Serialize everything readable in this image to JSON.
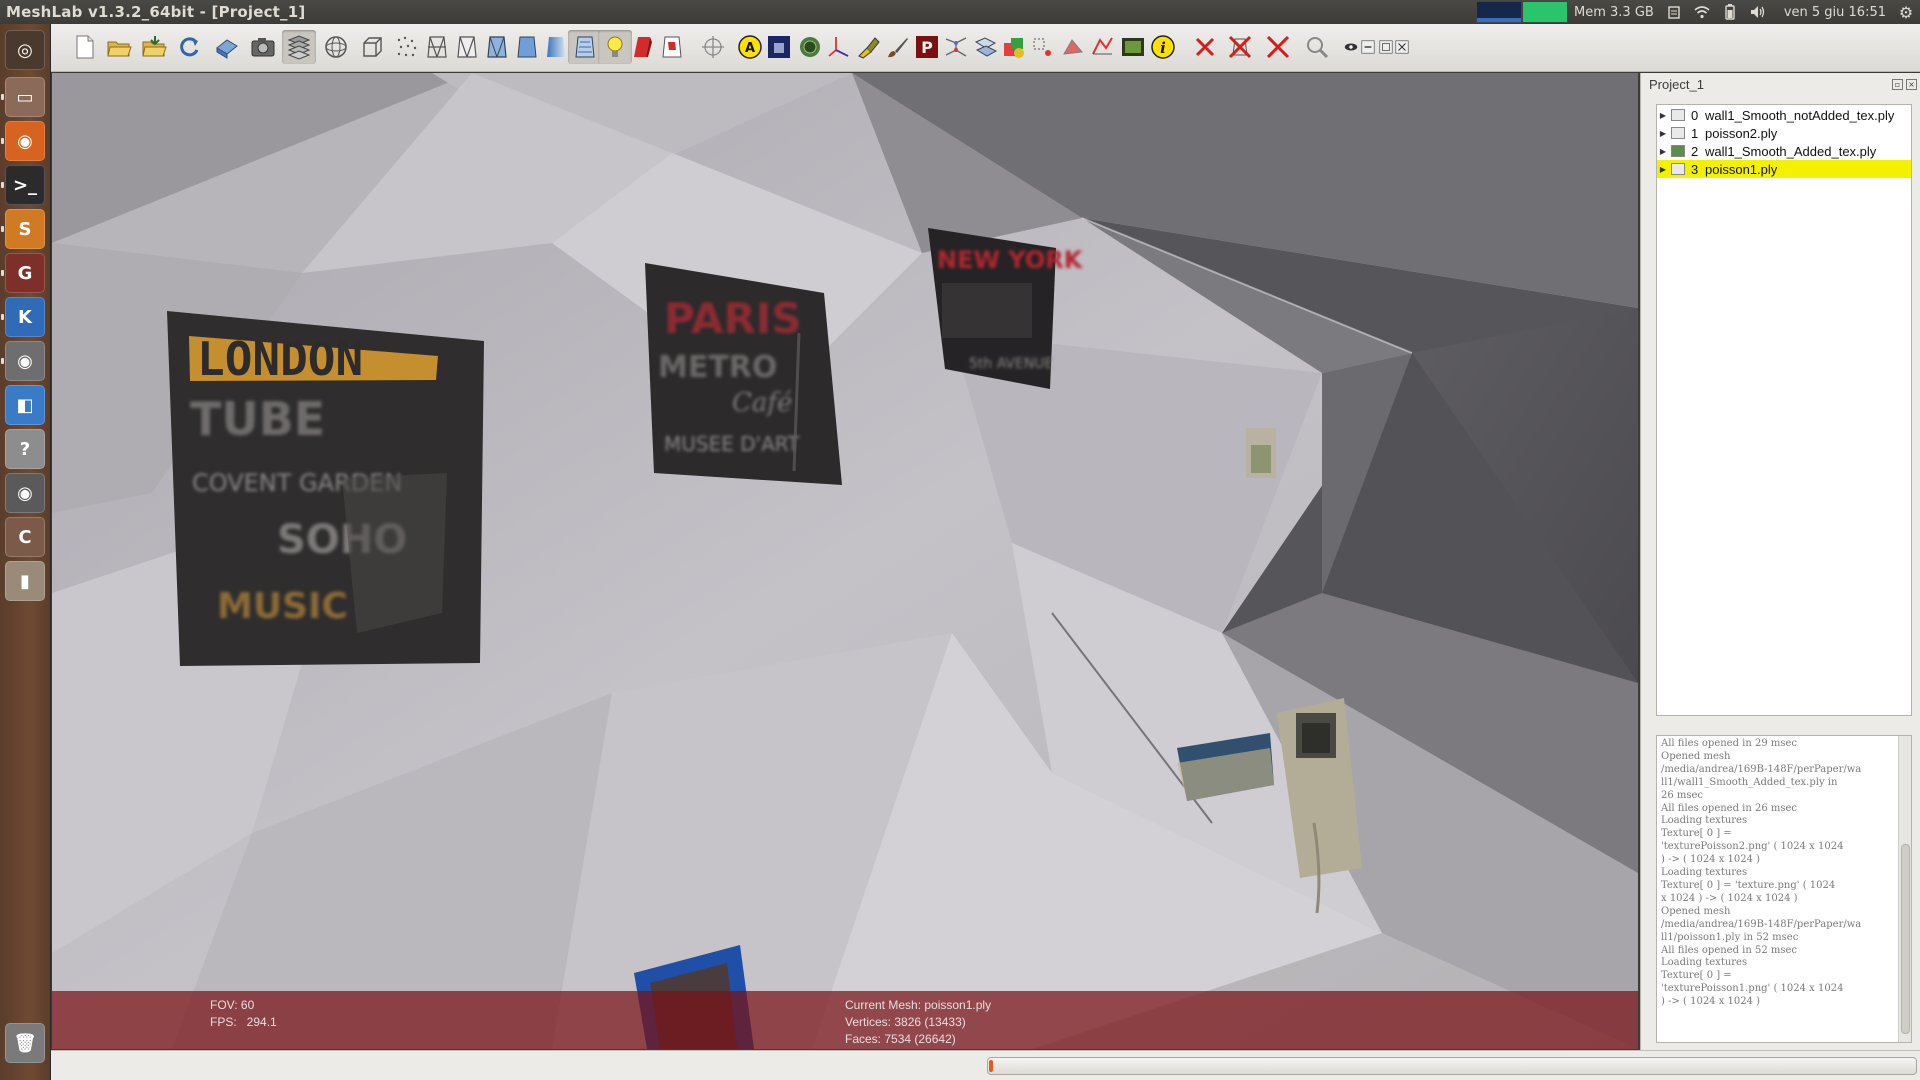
{
  "window": {
    "title": "MeshLab v1.3.2_64bit - [Project_1]"
  },
  "indicators": {
    "memory": "Mem 3.3 GB",
    "datetime": "ven  5 giu 16:51"
  },
  "launcher": {
    "items": [
      {
        "icon": "dash-home-icon",
        "color": "#4a3a2d"
      },
      {
        "icon": "files-icon",
        "color": "#8c6a5a"
      },
      {
        "icon": "firefox-icon",
        "color": "#d8621f"
      },
      {
        "icon": "terminal-icon",
        "color": "#2b2b2b"
      },
      {
        "icon": "sublime-text-icon",
        "color": "#d17a24"
      },
      {
        "icon": "meshlab-app-icon",
        "color": "#7e2f2a"
      },
      {
        "icon": "k-app-icon",
        "color": "#2f6bb6"
      },
      {
        "icon": "eye-app-icon",
        "color": "#6e6e6e"
      },
      {
        "icon": "launcher-app-icon",
        "color": "#3a7bc8"
      },
      {
        "icon": "help-icon",
        "color": "#8d8d8d"
      },
      {
        "icon": "eye-app-2-icon",
        "color": "#5a5a5a"
      },
      {
        "icon": "c-app-icon",
        "color": "#7b5a4a"
      },
      {
        "icon": "usb-drive-icon",
        "color": "#9a8a7a"
      },
      {
        "icon": "trash-icon",
        "color": "#7a7a7a"
      }
    ]
  },
  "toolbar": {
    "buttons": [
      {
        "icon": "new-project-icon"
      },
      {
        "icon": "open-project-icon"
      },
      {
        "icon": "import-mesh-icon"
      },
      {
        "icon": "reload-icon"
      },
      {
        "icon": "export-mesh-icon"
      },
      {
        "icon": "snapshot-icon"
      },
      {
        "icon": "layers-icon"
      },
      {
        "icon": "trackball-icon"
      },
      {
        "icon": "bounding-box-icon"
      },
      {
        "icon": "points-icon"
      },
      {
        "icon": "wireframe-icon"
      },
      {
        "icon": "hidden-lines-icon"
      },
      {
        "icon": "flat-lines-icon"
      },
      {
        "icon": "flat-shading-icon"
      },
      {
        "icon": "smooth-shading-icon"
      },
      {
        "icon": "texture-icon"
      },
      {
        "icon": "lighting-icon"
      },
      {
        "icon": "back-face-icon"
      },
      {
        "icon": "selected-faces-icon"
      },
      {
        "icon": "crosshair-icon"
      },
      {
        "icon": "annotation-icon"
      },
      {
        "icon": "raster-icon"
      },
      {
        "icon": "ao-icon"
      },
      {
        "icon": "axes-icon"
      },
      {
        "icon": "paint-icon"
      },
      {
        "icon": "brush-icon"
      },
      {
        "icon": "pick-points-icon"
      },
      {
        "icon": "align-icon"
      },
      {
        "icon": "mesh-align-icon"
      },
      {
        "icon": "color-icon"
      },
      {
        "icon": "select-vertices-icon"
      },
      {
        "icon": "select-faces-icon"
      },
      {
        "icon": "select-connected-icon"
      },
      {
        "icon": "image-align-icon"
      },
      {
        "icon": "info-icon"
      },
      {
        "icon": "delete-faces-icon"
      },
      {
        "icon": "delete-faces-vertices-icon"
      },
      {
        "icon": "delete-vertices-icon"
      },
      {
        "icon": "search-icon"
      },
      {
        "icon": "view-toggle-icon"
      },
      {
        "icon": "minimize-icon"
      },
      {
        "icon": "restore-icon"
      },
      {
        "icon": "close-icon"
      }
    ]
  },
  "viewport": {
    "fov_label": "FOV: 60",
    "fps_label": "FPS:   294.1",
    "current_mesh_label": "Current Mesh: poisson1.ply",
    "vertices_label": "Vertices: 3826 (13433)",
    "faces_label": "Faces: 7534 (26642)",
    "scene_text": {
      "london": "LONDON",
      "tube": "TUBE",
      "covent_garden": "COVENT GARDEN",
      "soho": "SOHO",
      "music": "MUSIC",
      "paris": "PARIS",
      "metro": "METRO",
      "cafe": "Café",
      "musee": "MUSEE D'ART",
      "newyork": "NEW YORK",
      "avenue": "5th AVENUE"
    }
  },
  "layers": {
    "title": "Project_1",
    "items": [
      {
        "index": "0",
        "name": "wall1_Smooth_notAdded_tex.ply",
        "visible": false,
        "selected": false
      },
      {
        "index": "1",
        "name": "poisson2.ply",
        "visible": false,
        "selected": false
      },
      {
        "index": "2",
        "name": "wall1_Smooth_Added_tex.ply",
        "visible": true,
        "selected": false
      },
      {
        "index": "3",
        "name": "poisson1.ply",
        "visible": false,
        "selected": true
      }
    ]
  },
  "log": {
    "text": "All files opened in 29 msec\nOpened mesh\n/media/andrea/169B-148F/perPaper/wa\nll1/wall1_Smooth_Added_tex.ply in\n26 msec\nAll files opened in 26 msec\nLoading textures\nTexture[ 0 ] =\n'texturePoisson2.png' ( 1024 x 1024\n) -> ( 1024 x 1024 )\nLoading textures\nTexture[ 0 ] = 'texture.png' ( 1024\nx 1024 ) -> ( 1024 x 1024 )\nOpened mesh\n/media/andrea/169B-148F/perPaper/wa\nll1/poisson1.ply in 52 msec\nAll files opened in 52 msec\nLoading textures\nTexture[ 0 ] =\n'texturePoisson1.png' ( 1024 x 1024\n) -> ( 1024 x 1024 )"
  }
}
